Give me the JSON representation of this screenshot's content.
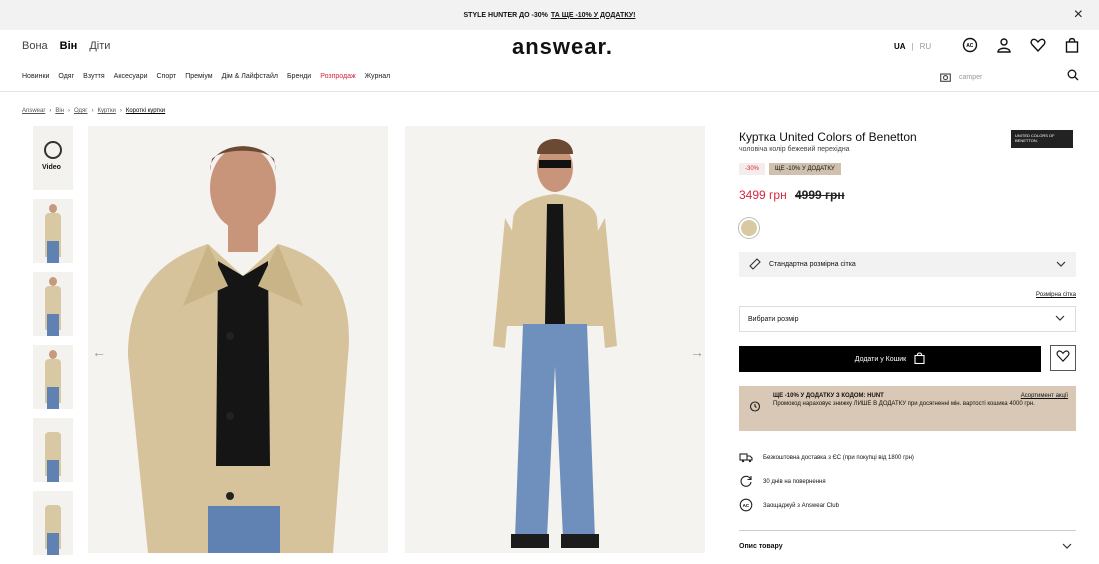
{
  "promo_bar": {
    "text": "STYLE HUNTER ДО -30%",
    "link": "ТА ЩЕ -10% У ДОДАТКУ!",
    "close": "×"
  },
  "header": {
    "gender": [
      "Вона",
      "Він",
      "Діти"
    ],
    "logo": "answear.",
    "lang": [
      "UA",
      "RU"
    ]
  },
  "nav": {
    "items": [
      "Новинки",
      "Одяг",
      "Взуття",
      "Аксесуари",
      "Спорт",
      "Преміум",
      "Дім & Лайфстайл",
      "Бренди",
      "Розпродаж",
      "Журнал"
    ],
    "search_placeholder": "camper"
  },
  "breadcrumbs": [
    "Answear",
    "Він",
    "Одяг",
    "Куртки",
    "Короткі куртки"
  ],
  "thumbs": {
    "video_label": "Video"
  },
  "product": {
    "title": "Куртка United Colors of Benetton",
    "subtitle": "чоловіча колір бежевий перехідна",
    "brand_logo": "UNITED COLORS OF BENETTON.",
    "badge_discount": "-30%",
    "badge_extra": "ЩЕ -10% У ДОДАТКУ",
    "price": "3499 грн",
    "old_price": "4999 грн",
    "swatch_color": "#d9c9a3",
    "size_guide": "Стандартна розмірна сітка",
    "size_table": "Розмірна сітка",
    "size_select": "Вибрати розмір",
    "add_to_cart": "Додати у Кошик",
    "promo_title": "ЩЕ -10% У ДОДАТКУ З КОДОМ: HUNT",
    "promo_link": "Асортимент акції",
    "promo_text": "Промокод нараховує знижку ЛИШЕ В ДОДАТКУ при досягненні мін. вартості кошика 4000 грн.",
    "features": [
      "Безкоштовна доставка з ЄС (при покупці від 1800 грн)",
      "30 днів на повернення",
      "Заощаджуй з Answear Club"
    ],
    "description": "Опис товару"
  }
}
